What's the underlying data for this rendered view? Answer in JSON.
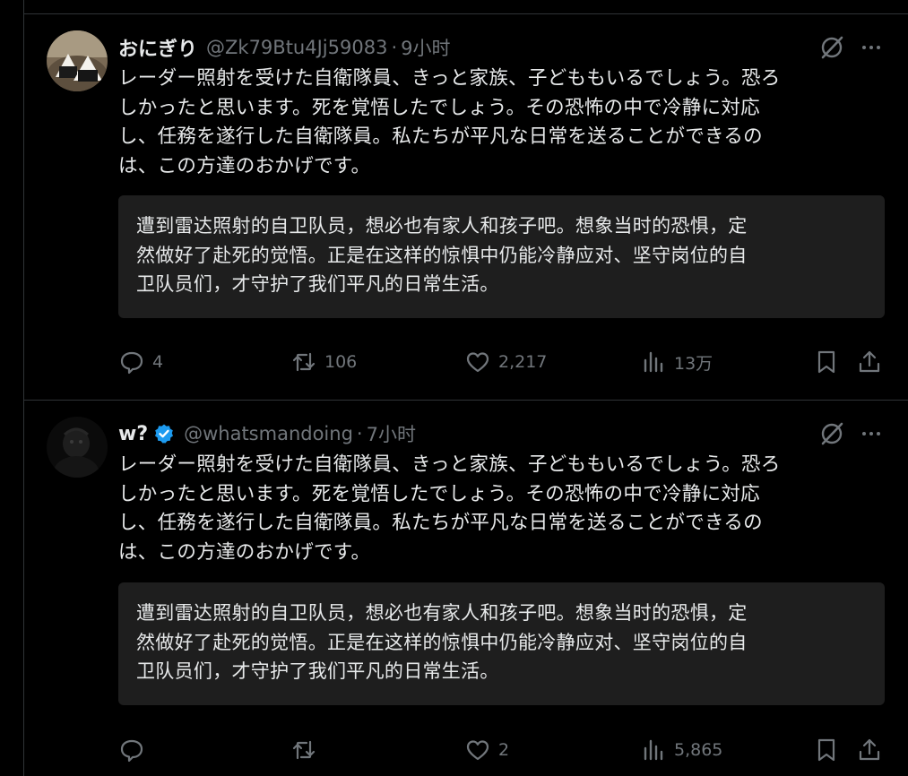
{
  "tweets": [
    {
      "name": "おにぎり",
      "handle": "@Zk79Btu4Jj59083",
      "separator": "·",
      "time": "9小时",
      "verified": false,
      "avatar_icon": "onigiri-avatar",
      "text_lines": [
        "レーダー照射を受けた自衛隊員、きっと家族、子どももいるでしょう。恐ろ",
        "しかったと思います。死を覚悟したでしょう。その恐怖の中で冷静に対応",
        "し、任務を遂行した自衛隊員。私たちが平凡な日常を送ることができるの",
        "は、この方達のおかげです。"
      ],
      "translation_lines": [
        "遭到雷达照射的自卫队员，想必也有家人和孩子吧。想象当时的恐惧，定",
        "然做好了赴死的觉悟。正是在这样的惊惧中仍能冷静应对、坚守岗位的自",
        "卫队员们，才守护了我们平凡的日常生活。"
      ],
      "replies": "4",
      "retweets": "106",
      "likes": "2,217",
      "views": "13万"
    },
    {
      "name": "w?",
      "handle": "@whatsmandoing",
      "separator": "·",
      "time": "7小时",
      "verified": true,
      "avatar_icon": "dark-figure-avatar",
      "text_lines": [
        "レーダー照射を受けた自衛隊員、きっと家族、子どももいるでしょう。恐ろ",
        "しかったと思います。死を覚悟したでしょう。その恐怖の中で冷静に対応",
        "し、任務を遂行した自衛隊員。私たちが平凡な日常を送ることができるの",
        "は、この方達のおかげです。"
      ],
      "translation_lines": [
        "遭到雷达照射的自卫队员，想必也有家人和孩子吧。想象当时的恐惧，定",
        "然做好了赴死的觉悟。正是在这样的惊惧中仍能冷静应对、坚守岗位的自",
        "卫队员们，才守护了我们平凡的日常生活。"
      ],
      "replies": "",
      "retweets": "",
      "likes": "2",
      "views": "5,865"
    }
  ],
  "colors": {
    "background": "#000000",
    "text": "#e7e9ea",
    "muted": "#71767b",
    "divider": "#2f3336",
    "translation_box": "#1e1e1e",
    "verified": "#1d9bf0"
  },
  "icons": [
    "grok-icon",
    "more-icon",
    "reply-icon",
    "retweet-icon",
    "like-icon",
    "views-icon",
    "bookmark-icon",
    "share-icon",
    "verified-badge-icon"
  ]
}
